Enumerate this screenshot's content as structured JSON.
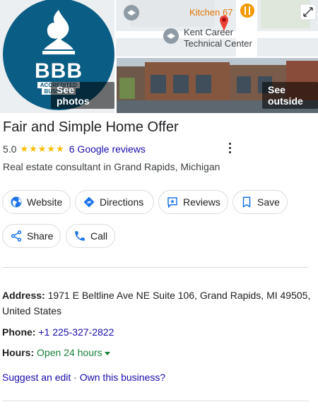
{
  "photos": {
    "logo": {
      "brand": "BBB",
      "badge_line1": "ACCREDITED",
      "badge_line2": "BUSINESS",
      "color": "#0a5d84"
    },
    "see_photos_label": "See photos",
    "see_outside_label": "See outside",
    "map_labels": {
      "restaurant": "Kitchen 67",
      "school_line1": "Kent Career",
      "school_line2": "Technical Center"
    },
    "expand_icon": "expand-icon"
  },
  "business": {
    "name": "Fair and Simple Home Offer",
    "rating": "5.0",
    "stars": "★★★★★",
    "rating_value": 5,
    "reviews_label": "6 Google reviews",
    "category": "Real estate consultant in Grand Rapids, Michigan"
  },
  "actions": {
    "website": {
      "label": "Website",
      "icon": "globe-icon"
    },
    "directions": {
      "label": "Directions",
      "icon": "directions-icon"
    },
    "reviews": {
      "label": "Reviews",
      "icon": "review-star-icon"
    },
    "save": {
      "label": "Save",
      "icon": "bookmark-icon"
    },
    "share": {
      "label": "Share",
      "icon": "share-icon"
    },
    "call": {
      "label": "Call",
      "icon": "phone-icon"
    }
  },
  "details": {
    "address_label": "Address:",
    "address": "1971 E Beltline Ave NE Suite 106, Grand Rapids, MI 49505, United States",
    "phone_label": "Phone:",
    "phone": "+1 225-327-2822",
    "hours_label": "Hours:",
    "hours_status": "Open 24 hours"
  },
  "footer_links": {
    "suggest": "Suggest an edit",
    "separator": " · ",
    "own": "Own this business?"
  },
  "colors": {
    "link": "#1a0dab",
    "star": "#fbbc04",
    "open": "#188038",
    "accent_icon": "#1a73e8"
  }
}
